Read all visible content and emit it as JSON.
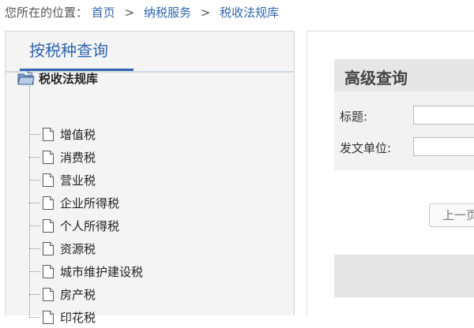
{
  "breadcrumb": {
    "prefix": "您所在的位置：",
    "items": [
      "首页",
      "纳税服务",
      "税收法规库"
    ],
    "separator": ">"
  },
  "left_panel": {
    "tab_label": "按税种查询",
    "tree": {
      "root_label": "税收法规库",
      "items": [
        "增值税",
        "消费税",
        "营业税",
        "企业所得税",
        "个人所得税",
        "资源税",
        "城市维护建设税",
        "房产税",
        "印花税"
      ]
    }
  },
  "search": {
    "title": "高级查询",
    "fields": [
      {
        "label": "标题:",
        "value": ""
      },
      {
        "label": "发文单位:",
        "value": ""
      }
    ],
    "prev_button": "上一页"
  },
  "colors": {
    "accent": "#2f66ad",
    "panel_bg": "#f4f4f4",
    "search_header_bg": "#e6e6e6"
  },
  "icons": {
    "root": "folder-icon",
    "item": "document-icon"
  }
}
